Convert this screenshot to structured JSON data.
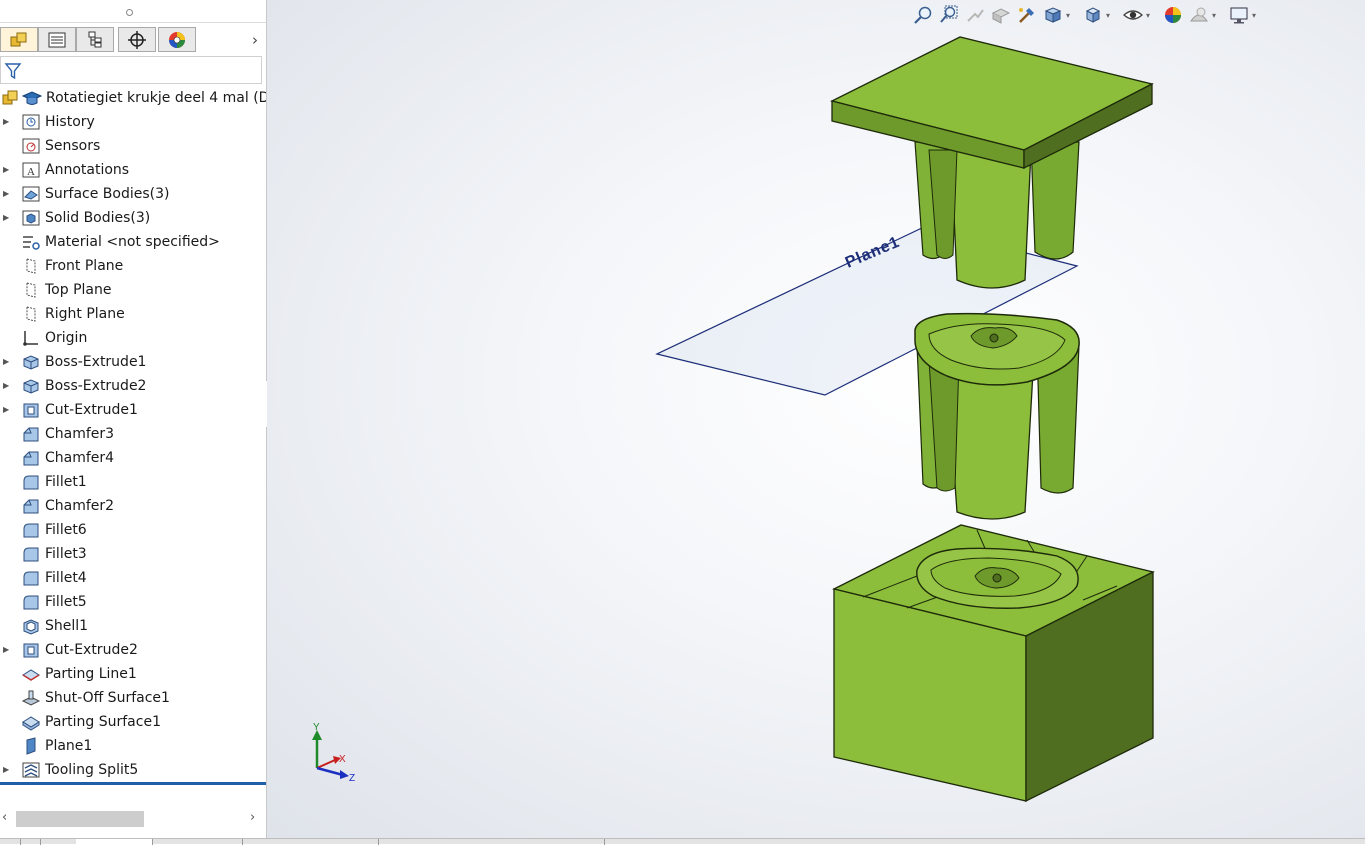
{
  "feature_tree": {
    "root_label": "Rotatiegiet krukje deel 4 mal  (De",
    "items": [
      {
        "label": "History",
        "expandable": true,
        "icon": "history-icon"
      },
      {
        "label": "Sensors",
        "expandable": false,
        "icon": "sensors-icon"
      },
      {
        "label": "Annotations",
        "expandable": true,
        "icon": "annotations-icon"
      },
      {
        "label": "Surface Bodies(3)",
        "expandable": true,
        "icon": "surface-bodies-icon"
      },
      {
        "label": "Solid Bodies(3)",
        "expandable": true,
        "icon": "solid-bodies-icon"
      },
      {
        "label": "Material <not specified>",
        "expandable": false,
        "icon": "material-icon"
      },
      {
        "label": "Front Plane",
        "expandable": false,
        "icon": "plane-icon"
      },
      {
        "label": "Top Plane",
        "expandable": false,
        "icon": "plane-icon"
      },
      {
        "label": "Right Plane",
        "expandable": false,
        "icon": "plane-icon"
      },
      {
        "label": "Origin",
        "expandable": false,
        "icon": "origin-icon"
      },
      {
        "label": "Boss-Extrude1",
        "expandable": true,
        "icon": "boss-extrude-icon"
      },
      {
        "label": "Boss-Extrude2",
        "expandable": true,
        "icon": "boss-extrude-icon"
      },
      {
        "label": "Cut-Extrude1",
        "expandable": true,
        "icon": "cut-extrude-icon"
      },
      {
        "label": "Chamfer3",
        "expandable": false,
        "icon": "chamfer-icon"
      },
      {
        "label": "Chamfer4",
        "expandable": false,
        "icon": "chamfer-icon"
      },
      {
        "label": "Fillet1",
        "expandable": false,
        "icon": "fillet-icon"
      },
      {
        "label": "Chamfer2",
        "expandable": false,
        "icon": "chamfer-icon"
      },
      {
        "label": "Fillet6",
        "expandable": false,
        "icon": "fillet-icon"
      },
      {
        "label": "Fillet3",
        "expandable": false,
        "icon": "fillet-icon"
      },
      {
        "label": "Fillet4",
        "expandable": false,
        "icon": "fillet-icon"
      },
      {
        "label": "Fillet5",
        "expandable": false,
        "icon": "fillet-icon"
      },
      {
        "label": "Shell1",
        "expandable": false,
        "icon": "shell-icon"
      },
      {
        "label": "Cut-Extrude2",
        "expandable": true,
        "icon": "cut-extrude-icon"
      },
      {
        "label": "Parting Line1",
        "expandable": false,
        "icon": "parting-line-icon"
      },
      {
        "label": "Shut-Off Surface1",
        "expandable": false,
        "icon": "shut-off-surface-icon"
      },
      {
        "label": "Parting Surface1",
        "expandable": false,
        "icon": "parting-surface-icon"
      },
      {
        "label": "Plane1",
        "expandable": false,
        "icon": "plane1-icon"
      },
      {
        "label": "Tooling Split5",
        "expandable": true,
        "icon": "tooling-split-icon"
      }
    ]
  },
  "panel_tabs": [
    {
      "name": "featuremanager-tab",
      "icon": "feature-manager-icon"
    },
    {
      "name": "propertymanager-tab",
      "icon": "property-manager-icon"
    },
    {
      "name": "configurationmanager-tab",
      "icon": "configuration-manager-icon"
    },
    {
      "name": "dimxpert-tab",
      "icon": "dimxpert-icon"
    },
    {
      "name": "display-manager-tab",
      "icon": "display-manager-icon"
    }
  ],
  "viewport": {
    "plane_label": "Plane1",
    "triad": {
      "x": "X",
      "y": "Y",
      "z": "Z"
    },
    "colors": {
      "model_face": "#8cbe3c",
      "model_side": "#6e9a2b",
      "model_dark": "#4f6e1f",
      "plane_edge": "#1d2e78"
    }
  },
  "view_toolbar": [
    "zoom-to-fit-icon",
    "zoom-to-area-icon",
    "previous-view-icon",
    "section-view-icon",
    "dynamic-annotation-icon",
    "view-orientation-icon",
    "display-style-icon",
    "hide-show-items-icon",
    "edit-appearance-icon",
    "apply-scene-icon",
    "view-settings-icon"
  ]
}
